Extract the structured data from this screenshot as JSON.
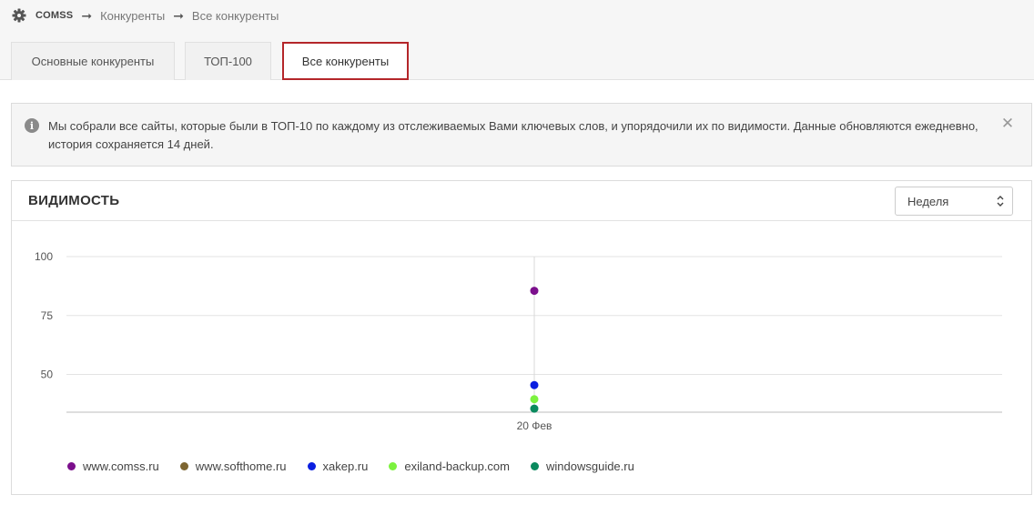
{
  "breadcrumb": {
    "project": "COMSS",
    "items": [
      "Конкуренты",
      "Все конкуренты"
    ]
  },
  "tabs": [
    {
      "label": "Основные конкуренты",
      "active": false
    },
    {
      "label": "ТОП-100",
      "active": false
    },
    {
      "label": "Все конкуренты",
      "active": true
    }
  ],
  "notice": {
    "text": "Мы собрали все сайты, которые были в ТОП-10 по каждому из отслеживаемых Вами ключевых слов, и упорядочили их по видимости. Данные обновляются ежедневно, история сохраняется 14 дней."
  },
  "panel": {
    "title": "ВИДИМОСТЬ",
    "period": "Неделя"
  },
  "icons": {
    "breadcrumb": "gear-icon",
    "notice": "info-icon",
    "close": "close-icon",
    "select": "select-caret-icon"
  },
  "colors": {
    "active_tab_border": "#b4262a"
  },
  "chart_data": {
    "type": "scatter",
    "categories": [
      "20 Фев"
    ],
    "y_ticks": [
      100,
      75,
      50
    ],
    "ylim": [
      34,
      100
    ],
    "grid": true,
    "legend": "bottom-left",
    "series": [
      {
        "name": "www.comss.ru",
        "color": "#7b0f8c",
        "values": [
          85.5
        ]
      },
      {
        "name": "www.softhome.ru",
        "color": "#7d6531",
        "values": [
          null
        ]
      },
      {
        "name": "xakep.ru",
        "color": "#0a1ee0",
        "values": [
          45.5
        ]
      },
      {
        "name": "exiland-backup.com",
        "color": "#7cf23e",
        "values": [
          39.5
        ]
      },
      {
        "name": "windowsguide.ru",
        "color": "#0b8a5e",
        "values": [
          35.5
        ]
      }
    ]
  }
}
